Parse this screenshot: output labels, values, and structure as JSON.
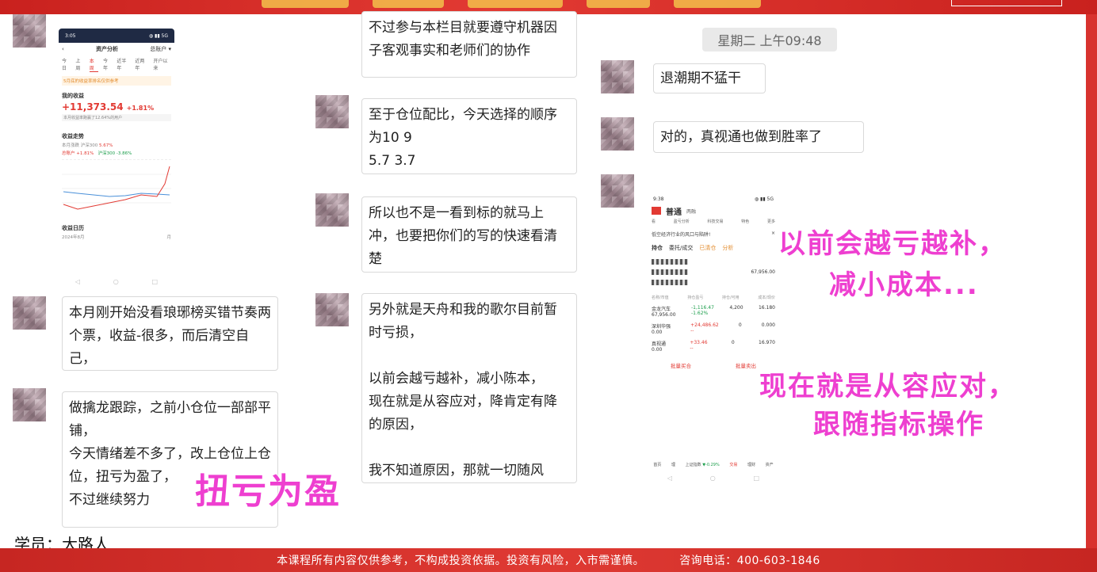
{
  "footer": {
    "disclaimer": "本课程所有内容仅供参考，不构成投资依据。投资有风险，入市需谨慎。",
    "hotline": "咨询电话：400-603-1846"
  },
  "student_label": "学员：大路人",
  "time_stamp": "星期二 上午09:48",
  "left_column": {
    "messages": [
      "本月刚开始没看琅琊榜买错节奏两个票，收益-很多，而后清空自己，",
      "做擒龙跟踪，之前小仓位一部部平铺，\n今天情绪差不多了，改上仓位上仓位，扭亏为盈了，\n不过继续努力"
    ]
  },
  "middle_column": {
    "messages": [
      "不过参与本栏目就要遵守机器因子客观事实和老师们的协作",
      "至于仓位配比，今天选择的顺序为10 9\n5.7 3.7",
      "所以也不是一看到标的就马上冲，也要把你们的写的快速看清楚",
      "另外就是天舟和我的歌尔目前暂时亏损，\n\n以前会越亏越补，减小陈本，\n现在就是从容应对，降肯定有降的原因，\n\n我不知道原因，那就一切随风"
    ]
  },
  "right_column": {
    "messages": [
      "退潮期不猛干",
      "对的，真视通也做到胜率了"
    ]
  },
  "overlays": {
    "profit": "扭亏为盈",
    "line1": "以前会越亏越补，",
    "line2": "减小成本...",
    "line3": "现在就是从容应对，",
    "line4": "跟随指标操作"
  },
  "phone1": {
    "status_time": "3:05",
    "nav_title": "资产分析",
    "account": "总账户 ▾",
    "back": "‹",
    "tabs": [
      "今日",
      "上周",
      "本周",
      "今年",
      "近半年",
      "近两年",
      "开户以来"
    ],
    "notice": "5月底的收益率排名仅供参考",
    "my_income_label": "我的收益",
    "income_value": "+11,373.54",
    "income_rate": "+1.81%",
    "income_sub": "本月收益率跑赢了12.64%的用户",
    "trend_label": "收益走势",
    "trend_sub": "本月涨跌 沪深300",
    "trend_sub_rate": "5.67%",
    "legend_account": "总账户 +1.81%",
    "legend_index": "沪深300 -3.86%",
    "calendar_label": "收益日历",
    "calendar_date": "2024年8月",
    "calendar_unit": "月"
  },
  "phone2": {
    "status_time": "9:38",
    "title": "普通",
    "subtitle": "两融",
    "menu": [
      "看",
      "盈亏分析",
      "科技交易",
      "特色",
      "更多"
    ],
    "tip": "低空经济行业的风口与陷阱!",
    "tab_position": "持仓",
    "tab_entrust": "委托/成交",
    "tab_cleared": "已清仓",
    "tab_analysis": "分析",
    "asset_value": "67,956.00",
    "header_cols": [
      "名称/市值",
      "持仓盈亏",
      "持仓/可用",
      "成本/现价"
    ],
    "rows": [
      {
        "name": "金龙汽车",
        "value": "67,956.00",
        "pl": "-1,116.47",
        "pl_rate": "-1.62%",
        "pos": "4,200",
        "cost": "16.180"
      },
      {
        "name": "深圳华强",
        "value": "0.00",
        "pl": "+24,486.62",
        "pl_rate": "--",
        "pos": "0",
        "cost": "0.000"
      },
      {
        "name": "真视通",
        "value": "0.00",
        "pl": "+33.46",
        "pl_rate": "--",
        "pos": "0",
        "cost": "16.970"
      }
    ],
    "btn_buy": "批量买合",
    "btn_sell": "批量卖出",
    "bottom_nav": [
      "首页",
      "理",
      "行情",
      "交易",
      "理财",
      "资产"
    ],
    "market": "上证指数",
    "market_rate": "▼-0.29%"
  }
}
